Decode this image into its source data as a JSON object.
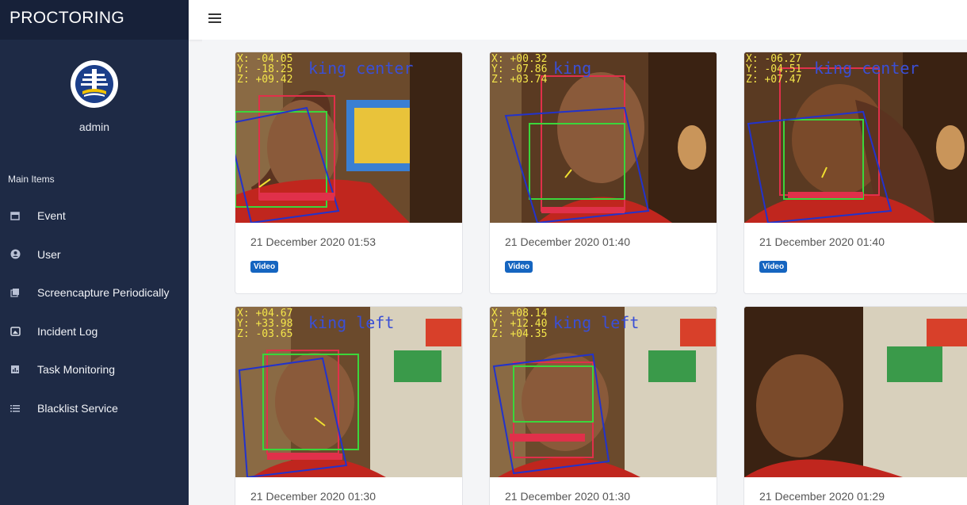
{
  "app": {
    "title": "PROCTORING"
  },
  "user": {
    "name": "admin"
  },
  "sidebar": {
    "section_label": "Main Items",
    "items": [
      {
        "label": "Event",
        "icon": "calendar-icon"
      },
      {
        "label": "User",
        "icon": "account-icon"
      },
      {
        "label": "Screencapture Periodically",
        "icon": "image-collection-icon"
      },
      {
        "label": "Incident Log",
        "icon": "picture-frame-icon"
      },
      {
        "label": "Task Monitoring",
        "icon": "bar-chart-icon"
      },
      {
        "label": "Blacklist Service",
        "icon": "list-icon"
      }
    ]
  },
  "cards": [
    {
      "date": "21 December 2020 01:53",
      "badge": "Video",
      "overlay": {
        "x": "X: -04.05",
        "y": "Y: -18.25",
        "z": "Z: +09.42",
        "status": "king center"
      }
    },
    {
      "date": "21 December 2020 01:40",
      "badge": "Video",
      "overlay": {
        "x": "X: +00.32",
        "y": "Y: -07.86",
        "z": "Z: +03.74",
        "status": "king"
      }
    },
    {
      "date": "21 December 2020 01:40",
      "badge": "Video",
      "overlay": {
        "x": "X: -06.27",
        "y": "Y: -04.51",
        "z": "Z: +07.47",
        "status": "king center"
      }
    },
    {
      "date": "21 December 2020 01:30",
      "badge": "",
      "overlay": {
        "x": "X: +04.67",
        "y": "Y: +33.98",
        "z": "Z: -03.65",
        "status": "king left"
      }
    },
    {
      "date": "21 December 2020 01:30",
      "badge": "",
      "overlay": {
        "x": "X: +08.14",
        "y": "Y: +12.40",
        "z": "Z: +04.35",
        "status": "king left"
      }
    },
    {
      "date": "21 December 2020 01:29",
      "badge": "",
      "overlay": {
        "x": "",
        "y": "",
        "z": "",
        "status": ""
      }
    }
  ]
}
